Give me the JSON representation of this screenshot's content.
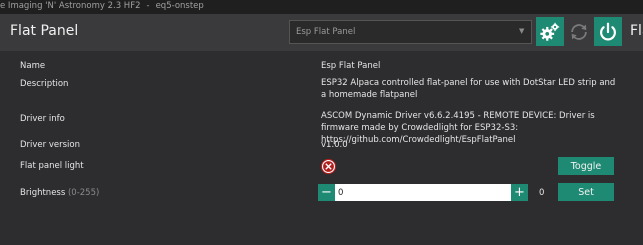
{
  "titlebar": {
    "app_title": "e Imaging 'N' Astronomy 2.3 HF2",
    "profile": "eq5-onstep"
  },
  "header": {
    "title": "Flat Panel",
    "right_title": "Fla",
    "device_select": {
      "value": "Esp Flat Panel"
    },
    "buttons": [
      {
        "name": "settings",
        "icon": "gear-icon"
      },
      {
        "name": "refresh",
        "icon": "refresh-icon"
      },
      {
        "name": "power",
        "icon": "power-icon"
      }
    ]
  },
  "info": {
    "name_label": "Name",
    "name_value": "Esp Flat Panel",
    "description_label": "Description",
    "description_value": "ESP32 Alpaca controlled flat-panel for use with DotStar LED strip and a homemade flatpanel",
    "driver_info_label": "Driver info",
    "driver_info_value": "ASCOM Dynamic Driver v6.6.2.4195 - REMOTE DEVICE: Driver is firmware made by Crowdedlight for ESP32-S3: https://github.com/Crowdedlight/EspFlatPanel",
    "driver_version_label": "Driver version",
    "driver_version_value": "v1.0.0"
  },
  "light": {
    "label": "Flat panel light",
    "status_icon": "off-x-circle-icon",
    "toggle_label": "Toggle"
  },
  "brightness": {
    "label": "Brightness",
    "range": "(0-255)",
    "input_value": "0",
    "current_value": "0",
    "set_label": "Set",
    "minus": "−",
    "plus": "+"
  },
  "colors": {
    "accent": "#1f8a73",
    "background": "#2d2d30",
    "header_bg": "#3a3a3c",
    "error_red": "#b01e1e"
  }
}
